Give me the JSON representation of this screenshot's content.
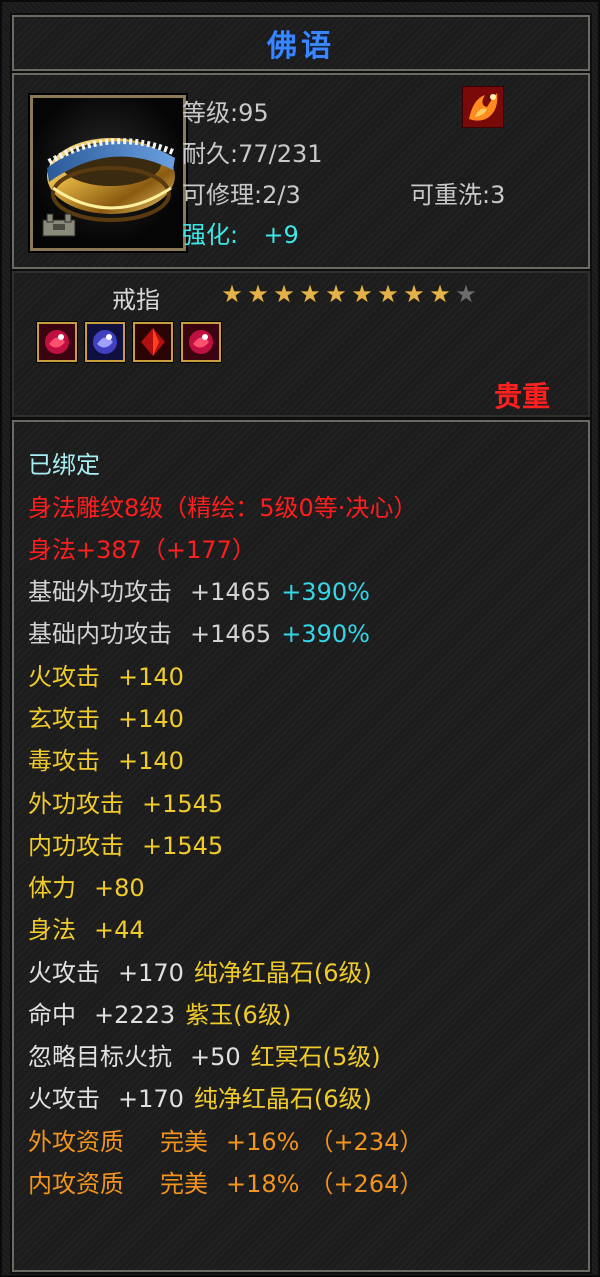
{
  "title": "佛语",
  "item": {
    "level_label": "等级:95",
    "durability_label": "耐久:77/231",
    "repair_label": "可修理:2/3",
    "reroll_label": "可重洗:3",
    "enhance_label": "强化:",
    "enhance_value": "+9",
    "type_name": "戒指",
    "stars_total": 10,
    "stars_filled": 9,
    "quality": "贵重"
  },
  "stats": {
    "bound": "已绑定",
    "engrave": "身法雕纹8级（精绘：5级0等·决心）",
    "agility_main": "身法+387（+177）",
    "base_ext_attack": {
      "label": "基础外功攻击",
      "value": "+1465",
      "pct": "+390%"
    },
    "base_int_attack": {
      "label": "基础内功攻击",
      "value": "+1465",
      "pct": "+390%"
    },
    "fire_attack": {
      "label": "火攻击",
      "value": "+140"
    },
    "dark_attack": {
      "label": "玄攻击",
      "value": "+140"
    },
    "poison_attack": {
      "label": "毒攻击",
      "value": "+140"
    },
    "ext_attack": {
      "label": "外功攻击",
      "value": "+1545"
    },
    "int_attack": {
      "label": "内功攻击",
      "value": "+1545"
    },
    "stamina": {
      "label": "体力",
      "value": "+80"
    },
    "agility": {
      "label": "身法",
      "value": "+44"
    },
    "gem1": {
      "label": "火攻击",
      "value": "+170",
      "gem": "纯净红晶石(6级)"
    },
    "gem2": {
      "label": "命中",
      "value": "+2223",
      "gem": "紫玉(6级)"
    },
    "gem3": {
      "label": "忽略目标火抗",
      "value": "+50",
      "gem": "红冥石(5级)"
    },
    "gem4": {
      "label": "火攻击",
      "value": "+170",
      "gem": "纯净红晶石(6级)"
    },
    "apt1": {
      "label": "外攻资质",
      "grade": "完美",
      "value": "+16%",
      "extra": "（+234）"
    },
    "apt2": {
      "label": "内攻资质",
      "grade": "完美",
      "value": "+18%",
      "extra": "（+264）"
    }
  },
  "colors": {
    "title": "#3a86ff",
    "bound": "#a6eef2",
    "engrave": "#ff1e1e",
    "base": "#d2d2d2",
    "bonus": "#36d6e8",
    "yellow": "#f0cb2c",
    "aptitude": "#f3941e",
    "quality": "#ff2020"
  },
  "icons": {
    "item": "gold-ring-icon",
    "lock": "bound-lock-icon",
    "gem_badge": "fire-phoenix-gem-icon",
    "sockets": [
      "red-gem-socket-icon",
      "purple-gem-socket-icon",
      "red-crystal-socket-icon",
      "red-gem-socket-icon"
    ]
  }
}
